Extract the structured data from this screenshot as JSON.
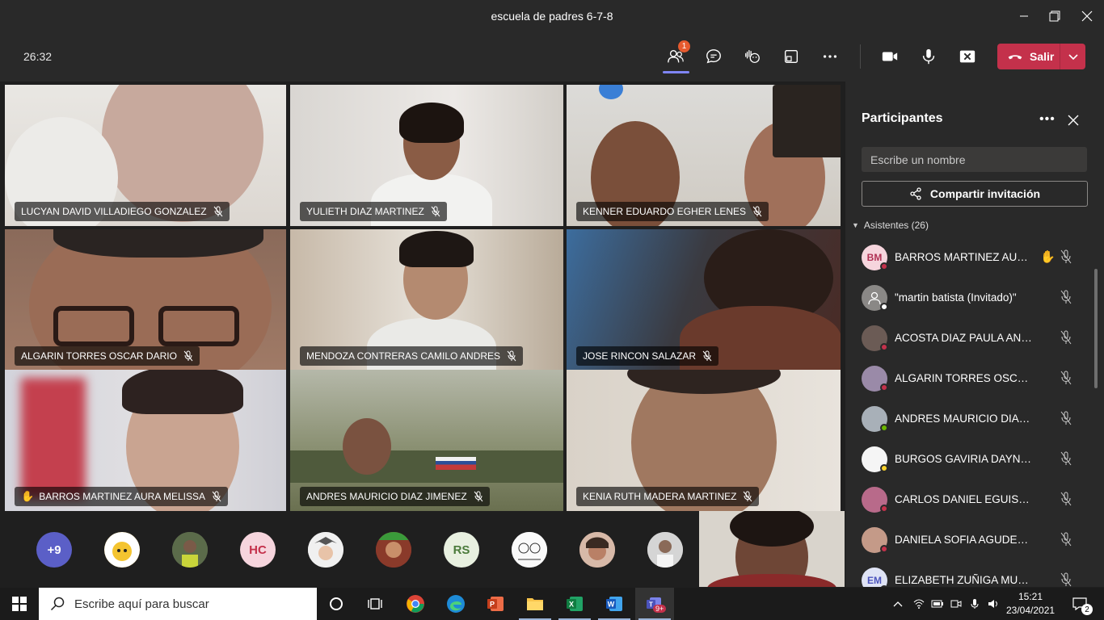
{
  "window": {
    "title": "escuela de padres 6-7-8",
    "minimize_icon": "minimize-icon",
    "maximize_icon": "restore-icon",
    "close_icon": "close-icon"
  },
  "toolbar": {
    "timer": "26:32",
    "participants_badge": "1",
    "leave_label": "Salir"
  },
  "grid": [
    {
      "name": "LUCYAN DAVID VILLADIEGO GONZALEZ",
      "hand": false
    },
    {
      "name": "YULIETH DIAZ MARTINEZ",
      "hand": false
    },
    {
      "name": "KENNER EDUARDO EGHER LENES",
      "hand": false
    },
    {
      "name": "ALGARIN TORRES OSCAR DARIO",
      "hand": false
    },
    {
      "name": "MENDOZA CONTRERAS CAMILO ANDRES",
      "hand": false
    },
    {
      "name": "JOSE RINCON SALAZAR",
      "hand": false
    },
    {
      "name": "BARROS MARTINEZ AURA MELISSA",
      "hand": true
    },
    {
      "name": "ANDRES MAURICIO DIAZ JIMENEZ",
      "hand": false
    },
    {
      "name": "KENIA RUTH MADERA MARTINEZ",
      "hand": false
    }
  ],
  "strip": {
    "overflow": "+9",
    "initials_1": "HC",
    "initials_2": "RS"
  },
  "panel": {
    "title": "Participantes",
    "search_placeholder": "Escribe un nombre",
    "invite_label": "Compartir invitación",
    "section_label": "Asistentes (26)",
    "participants": [
      {
        "initials": "BM",
        "name": "BARROS MARTINEZ AUR...",
        "hand": true,
        "status": "busy"
      },
      {
        "initials": "",
        "name": "\"martin batista (Invitado)\"",
        "hand": false,
        "status": "guest"
      },
      {
        "initials": "",
        "name": "ACOSTA DIAZ PAULA ANDREA",
        "hand": false,
        "status": "busy"
      },
      {
        "initials": "",
        "name": "ALGARIN TORRES OSCAR DA...",
        "hand": false,
        "status": "busy"
      },
      {
        "initials": "",
        "name": "ANDRES MAURICIO DIAZ JIM...",
        "hand": false,
        "status": "available"
      },
      {
        "initials": "",
        "name": "BURGOS GAVIRIA DAYNA PAT...",
        "hand": false,
        "status": "away"
      },
      {
        "initials": "",
        "name": "CARLOS DANIEL EGUIS DIAZ",
        "hand": false,
        "status": "busy"
      },
      {
        "initials": "",
        "name": "DANIELA SOFIA AGUDELO M...",
        "hand": false,
        "status": "busy"
      },
      {
        "initials": "EM",
        "name": "ELIZABETH ZUÑIGA MULATO",
        "hand": false,
        "status": "busy"
      }
    ]
  },
  "taskbar": {
    "search_placeholder": "Escribe aquí para buscar",
    "time": "15:21",
    "date": "23/04/2021",
    "notification_count": "2",
    "teams_badge": "9+"
  },
  "colors": {
    "accent": "#7f85f5",
    "leave": "#c4314b",
    "busy": "#c4314b",
    "available": "#6bb700",
    "away": "#f8d22a"
  }
}
